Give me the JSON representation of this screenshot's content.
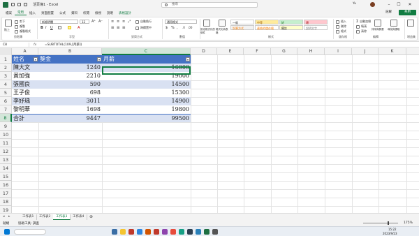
{
  "window": {
    "title": "活頁簿1 - Excel",
    "search_placeholder": "搜尋",
    "user": "Yu",
    "comment_label": "註解",
    "share_label": "共用"
  },
  "tabs": [
    "檔案",
    "常用",
    "插入",
    "頁面配置",
    "公式",
    "資料",
    "校閱",
    "檢視",
    "說明",
    "表格設計"
  ],
  "ribbon": {
    "clipboard": {
      "paste": "貼上",
      "cut": "剪下",
      "copy": "複製",
      "format_painter": "複製格式",
      "label": "剪貼簿"
    },
    "font": {
      "name": "新細明體",
      "size": "12",
      "label": "字型"
    },
    "alignment": {
      "wrap": "自動換行",
      "merge": "跨欄置中",
      "label": "對齊方式"
    },
    "number": {
      "format": "通用格式",
      "label": "數值"
    },
    "styles": {
      "cond": "設定格式化的條件",
      "table": "格式化為表格",
      "cells": [
        {
          "text": "一般",
          "bg": "#ffffff",
          "fg": "#222222"
        },
        {
          "text": "中等",
          "bg": "#ffeb9c",
          "fg": "#9c5700"
        },
        {
          "text": "好",
          "bg": "#c6efce",
          "fg": "#006100"
        },
        {
          "text": "壞",
          "bg": "#ffc7ce",
          "fg": "#9c0006"
        },
        {
          "text": "計算方式",
          "bg": "#f2f2f2",
          "fg": "#fa7d00"
        },
        {
          "text": "連結的儲存格",
          "bg": "#ffffff",
          "fg": "#fa7d00"
        },
        {
          "text": "備註",
          "bg": "#ffffcc",
          "fg": "#222222"
        },
        {
          "text": "說明文字",
          "bg": "#ffffff",
          "fg": "#7f7f7f"
        }
      ],
      "label": "樣式"
    },
    "cells_grp": {
      "insert": "插入",
      "delete": "刪除",
      "format": "格式",
      "label": "儲存格"
    },
    "editing": {
      "autosum": "自動加總",
      "fill": "填滿",
      "clear": "清除",
      "sort": "排序與篩選",
      "find": "尋找與選取",
      "label": "編輯"
    },
    "addins": {
      "label": "增益集"
    }
  },
  "formula_bar": {
    "namebox": "C8",
    "fx": "fx",
    "formula": "=SUBTOTAL(109,[月薪])"
  },
  "columns": [
    "A",
    "B",
    "C",
    "D",
    "E",
    "F",
    "G",
    "H",
    "I",
    "J",
    "K"
  ],
  "rows": [
    "1",
    "2",
    "3",
    "4",
    "5",
    "6",
    "7",
    "8",
    "9",
    "10",
    "11",
    "12",
    "13",
    "14",
    "15",
    "16",
    "17",
    "18",
    "19"
  ],
  "table": {
    "headers": [
      "姓名",
      "獎金",
      "月薪"
    ],
    "data": [
      [
        "陳大文",
        "1240",
        "16000"
      ],
      [
        "黃加強",
        "2210",
        "19000"
      ],
      [
        "張國良",
        "590",
        "14500"
      ],
      [
        "王子俊",
        "698",
        "15300"
      ],
      [
        "李妤瑀",
        "3011",
        "14900"
      ],
      [
        "黎明華",
        "1698",
        "19800"
      ]
    ],
    "total": [
      "合計",
      "9447",
      "99500"
    ]
  },
  "sheets": [
    "工作表1",
    "工作表2",
    "工作表3",
    "工作表4"
  ],
  "status": {
    "ready": "就緒",
    "accessibility": "協助工具: 調查",
    "zoom": "175%"
  },
  "taskbar": {
    "time": "15:22",
    "date": "2023/9/23"
  }
}
